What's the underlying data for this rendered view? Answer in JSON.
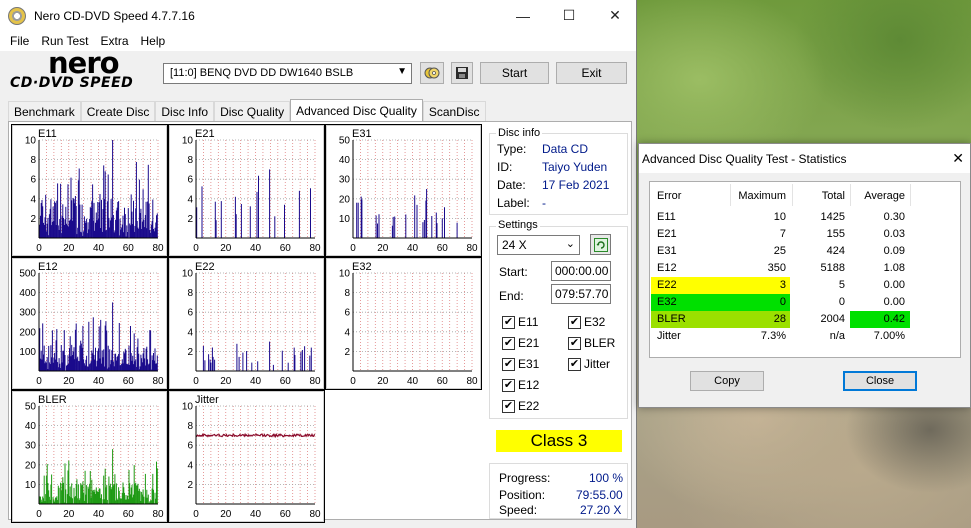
{
  "window": {
    "title": "Nero CD-DVD Speed 4.7.7.16"
  },
  "menu": [
    "File",
    "Run Test",
    "Extra",
    "Help"
  ],
  "logo": {
    "brand": "nero",
    "sub": "CD·DVD SPEED"
  },
  "toolbar": {
    "drive": "[11:0]   BENQ DVD DD DW1640 BSLB",
    "start_label": "Start",
    "exit_label": "Exit"
  },
  "tabs": [
    "Benchmark",
    "Create Disc",
    "Disc Info",
    "Disc Quality",
    "Advanced Disc Quality",
    "ScanDisc"
  ],
  "active_tab": "Advanced Disc Quality",
  "disc_info": {
    "title": "Disc info",
    "type_label": "Type:",
    "type": "Data CD",
    "id_label": "ID:",
    "id": "Taiyo Yuden",
    "date_label": "Date:",
    "date": "17 Feb 2021",
    "label_label": "Label:",
    "label": "-"
  },
  "settings": {
    "title": "Settings",
    "speed": "24 X",
    "start_label": "Start:",
    "start": "000:00.00",
    "end_label": "End:",
    "end": "079:57.70",
    "checks": [
      {
        "label": "E11",
        "checked": true
      },
      {
        "label": "E32",
        "checked": true
      },
      {
        "label": "E21",
        "checked": true
      },
      {
        "label": "BLER",
        "checked": true
      },
      {
        "label": "E31",
        "checked": true
      },
      {
        "label": "Jitter",
        "checked": true
      },
      {
        "label": "E12",
        "checked": true
      },
      {
        "label": "E22",
        "checked": true
      }
    ]
  },
  "class_label": "Class 3",
  "progress": {
    "progress_label": "Progress:",
    "progress": "100 %",
    "position_label": "Position:",
    "position": "79:55.00",
    "speed_label": "Speed:",
    "speed": "27.20 X"
  },
  "chart_data": [
    {
      "type": "bar",
      "title": "E11",
      "xlim": [
        0,
        80
      ],
      "ylim": [
        0,
        10
      ],
      "yticks": [
        2,
        4,
        6,
        8,
        10
      ],
      "xticks": [
        0,
        20,
        40,
        60,
        80
      ],
      "color": "#1a0a8c",
      "peak": 10,
      "total": 1425,
      "average": 0.3
    },
    {
      "type": "bar",
      "title": "E21",
      "xlim": [
        0,
        80
      ],
      "ylim": [
        0,
        10
      ],
      "yticks": [
        2,
        4,
        6,
        8,
        10
      ],
      "xticks": [
        0,
        20,
        40,
        60,
        80
      ],
      "color": "#1a0a8c",
      "peak": 7,
      "total": 155,
      "average": 0.03
    },
    {
      "type": "bar",
      "title": "E31",
      "xlim": [
        0,
        80
      ],
      "ylim": [
        0,
        50
      ],
      "yticks": [
        10,
        20,
        30,
        40,
        50
      ],
      "xticks": [
        0,
        20,
        40,
        60,
        80
      ],
      "color": "#1a0a8c",
      "peak": 25,
      "total": 424,
      "average": 0.09
    },
    {
      "type": "bar",
      "title": "E12",
      "xlim": [
        0,
        80
      ],
      "ylim": [
        0,
        500
      ],
      "yticks": [
        100,
        200,
        300,
        400,
        500
      ],
      "xticks": [
        0,
        20,
        40,
        60,
        80
      ],
      "color": "#1a0a8c",
      "peak": 350,
      "total": 5188,
      "average": 1.08
    },
    {
      "type": "bar",
      "title": "E22",
      "xlim": [
        0,
        80
      ],
      "ylim": [
        0,
        10
      ],
      "yticks": [
        2,
        4,
        6,
        8,
        10
      ],
      "xticks": [
        0,
        20,
        40,
        60,
        80
      ],
      "color": "#1a0a8c",
      "peak": 3,
      "total": 5,
      "average": 0.0
    },
    {
      "type": "bar",
      "title": "E32",
      "xlim": [
        0,
        80
      ],
      "ylim": [
        0,
        10
      ],
      "yticks": [
        2,
        4,
        6,
        8,
        10
      ],
      "xticks": [
        0,
        20,
        40,
        60,
        80
      ],
      "color": "#1a0a8c",
      "peak": 0,
      "total": 0,
      "average": 0.0
    },
    {
      "type": "bar",
      "title": "BLER",
      "xlim": [
        0,
        80
      ],
      "ylim": [
        0,
        50
      ],
      "yticks": [
        10,
        20,
        30,
        40,
        50
      ],
      "xticks": [
        0,
        20,
        40,
        60,
        80
      ],
      "color": "#1f9a14",
      "peak": 28,
      "total": 2004,
      "average": 0.42
    },
    {
      "type": "line",
      "title": "Jitter",
      "xlim": [
        0,
        80
      ],
      "ylim": [
        0,
        10
      ],
      "yticks": [
        2,
        4,
        6,
        8,
        10
      ],
      "xticks": [
        0,
        20,
        40,
        60,
        80
      ],
      "color": "#8b0a2a",
      "level": 7.0
    }
  ],
  "dialog": {
    "title": "Advanced Disc Quality Test - Statistics",
    "headers": [
      "Error",
      "Maximum",
      "Total",
      "Average"
    ],
    "rows": [
      {
        "error": "E11",
        "maximum": "10",
        "total": "1425",
        "average": "0.30"
      },
      {
        "error": "E21",
        "maximum": "7",
        "total": "155",
        "average": "0.03"
      },
      {
        "error": "E31",
        "maximum": "25",
        "total": "424",
        "average": "0.09"
      },
      {
        "error": "E12",
        "maximum": "350",
        "total": "5188",
        "average": "1.08"
      },
      {
        "error": "E22",
        "maximum": "3",
        "total": "5",
        "average": "0.00",
        "highlight": "#ffff00"
      },
      {
        "error": "E32",
        "maximum": "0",
        "total": "0",
        "average": "0.00",
        "highlight": "#00e000"
      },
      {
        "error": "BLER",
        "maximum": "28",
        "total": "2004",
        "average": "0.42",
        "highlight": "#9be000",
        "avg_highlight": "#00e000"
      },
      {
        "error": "Jitter",
        "maximum": "7.3%",
        "total": "n/a",
        "average": "7.00%"
      }
    ],
    "copy_label": "Copy",
    "close_label": "Close"
  }
}
